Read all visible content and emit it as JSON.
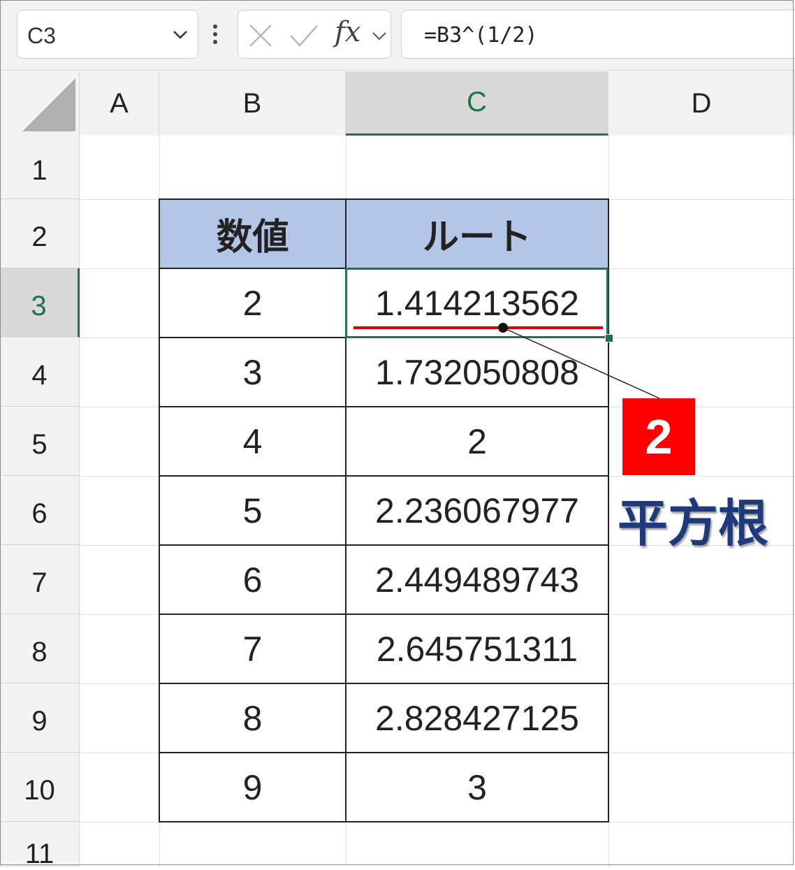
{
  "formula_bar": {
    "name_box": "C3",
    "fx_label": "fx",
    "formula": "=B3^(1/2)"
  },
  "columns": [
    "A",
    "B",
    "C",
    "D"
  ],
  "selected_column": "C",
  "rows": [
    "1",
    "2",
    "3",
    "4",
    "5",
    "6",
    "7",
    "8",
    "9",
    "10",
    "11"
  ],
  "selected_row": "3",
  "table": {
    "headers": [
      "数値",
      "ルート"
    ],
    "rows": [
      [
        "2",
        "1.414213562"
      ],
      [
        "3",
        "1.732050808"
      ],
      [
        "4",
        "2"
      ],
      [
        "5",
        "2.236067977"
      ],
      [
        "6",
        "2.449489743"
      ],
      [
        "7",
        "2.645751311"
      ],
      [
        "8",
        "2.828427125"
      ],
      [
        "9",
        "3"
      ]
    ]
  },
  "annotation": {
    "badge": "2",
    "label": "平方根"
  },
  "colors": {
    "header_fill": "#b4c6e7",
    "selection": "#217346",
    "badge": "#ff0000",
    "underline": "#e00000",
    "label": "#1f3a7a"
  },
  "icons": {
    "name_box_dropdown": "chevron-down-icon",
    "more": "vertical-dots-icon",
    "cancel": "x-icon",
    "enter": "check-icon",
    "function_dropdown": "chevron-down-icon",
    "select_all": "select-all-triangle-icon"
  }
}
